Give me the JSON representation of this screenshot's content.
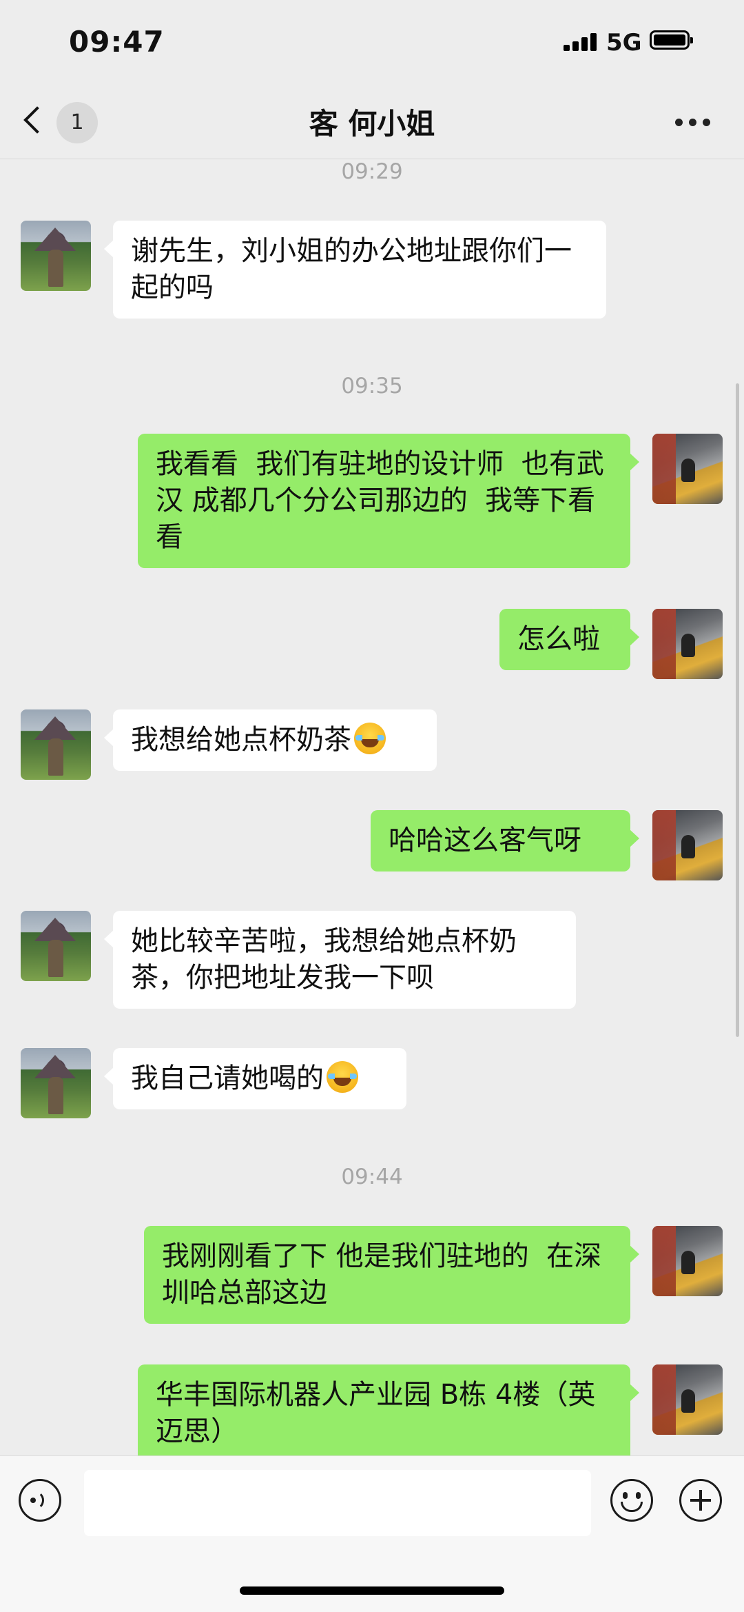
{
  "status_bar": {
    "time": "09:47",
    "network": "5G"
  },
  "nav": {
    "unread_count": "1",
    "title": "客 何小姐"
  },
  "chat": {
    "timestamps": [
      "09:29",
      "09:35",
      "09:44"
    ],
    "messages": [
      {
        "side": "in",
        "text": "谢先生，刘小姐的办公地址跟你们一起的吗"
      },
      {
        "side": "out",
        "text": "我看看  我们有驻地的设计师  也有武汉 成都几个分公司那边的  我等下看看"
      },
      {
        "side": "out",
        "text": "怎么啦"
      },
      {
        "side": "in",
        "text": "我想给她点杯奶茶",
        "emoji": "tears-of-joy-emoji"
      },
      {
        "side": "out",
        "text": "哈哈这么客气呀"
      },
      {
        "side": "in",
        "text": "她比较辛苦啦，我想给她点杯奶茶，你把地址发我一下呗"
      },
      {
        "side": "in",
        "text": "我自己请她喝的",
        "emoji": "tears-of-joy-emoji"
      },
      {
        "side": "out",
        "text": "我刚刚看了下 他是我们驻地的  在深圳哈总部这边"
      },
      {
        "side": "out",
        "text": "华丰国际机器人产业园 B栋 4楼（英迈思）"
      }
    ]
  },
  "input_bar": {
    "placeholder": ""
  },
  "colors": {
    "background": "#ededed",
    "incoming_bubble": "#ffffff",
    "outgoing_bubble": "#95ec69",
    "timestamp": "#a6a6a6"
  }
}
